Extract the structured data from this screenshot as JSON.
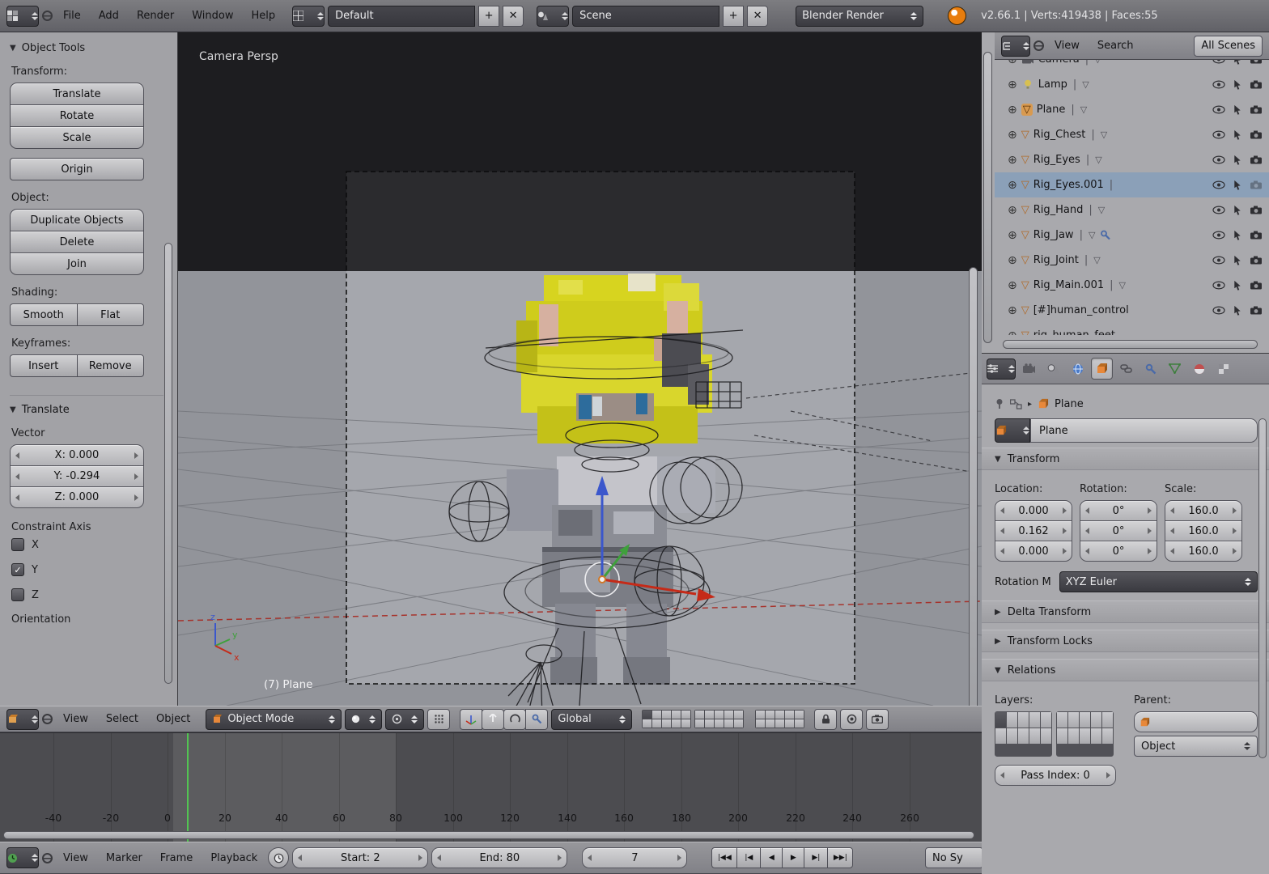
{
  "topbar": {
    "menus": [
      "File",
      "Add",
      "Render",
      "Window",
      "Help"
    ],
    "layout": "Default",
    "scene": "Scene",
    "engine": "Blender Render",
    "stats": "v2.66.1 | Verts:419438 | Faces:55"
  },
  "tool_shelf": {
    "title": "Object Tools",
    "transform_label": "Transform:",
    "translate": "Translate",
    "rotate": "Rotate",
    "scale": "Scale",
    "origin": "Origin",
    "object_label": "Object:",
    "duplicate": "Duplicate Objects",
    "delete": "Delete",
    "join": "Join",
    "shading_label": "Shading:",
    "smooth": "Smooth",
    "flat": "Flat",
    "keyframes_label": "Keyframes:",
    "insert": "Insert",
    "remove": "Remove",
    "translate_panel": "Translate",
    "vector_label": "Vector",
    "vx": "X: 0.000",
    "vy": "Y: -0.294",
    "vz": "Z: 0.000",
    "constraint_label": "Constraint Axis",
    "ax": "X",
    "ay": "Y",
    "az": "Z",
    "orientation_label": "Orientation"
  },
  "viewport": {
    "camera_label": "Camera Persp",
    "object_label": "(7) Plane",
    "menus": [
      "View",
      "Select",
      "Object"
    ],
    "mode": "Object Mode",
    "orientation": "Global",
    "axis_x": "x",
    "axis_y": "y",
    "axis_z": "z"
  },
  "timeline": {
    "ticks": [
      "-40",
      "-20",
      "0",
      "20",
      "40",
      "60",
      "80",
      "100",
      "120",
      "140",
      "160",
      "180",
      "200",
      "220",
      "240",
      "260"
    ],
    "menus": [
      "View",
      "Marker",
      "Frame",
      "Playback"
    ],
    "start": "Start: 2",
    "end": "End: 80",
    "frame": "7",
    "playback": [
      "|◀◀",
      "|◀",
      "◀",
      "▶",
      "▶|",
      "▶▶|"
    ],
    "sync": "No Sy"
  },
  "outliner": {
    "menus": [
      "View",
      "Search"
    ],
    "scope": "All Scenes",
    "items": [
      "Camera",
      "Lamp",
      "Plane",
      "Rig_Chest",
      "Rig_Eyes",
      "Rig_Eyes.001",
      "Rig_Hand",
      "Rig_Jaw",
      "Rig_Joint",
      "Rig_Main.001",
      "[#]human_control",
      "rig_human_feet"
    ]
  },
  "properties": {
    "breadcrumb": "Plane",
    "name": "Plane",
    "transform_title": "Transform",
    "location_label": "Location:",
    "rotation_label": "Rotation:",
    "scale_label": "Scale:",
    "location": [
      "0.000",
      "0.162",
      "0.000"
    ],
    "rotation": [
      "0°",
      "0°",
      "0°"
    ],
    "scale": [
      "160.0",
      "160.0",
      "160.0"
    ],
    "rotation_mode_label": "Rotation M",
    "rotation_mode": "XYZ Euler",
    "delta_title": "Delta Transform",
    "locks_title": "Transform Locks",
    "relations_title": "Relations",
    "layers_label": "Layers:",
    "parent_label": "Parent:",
    "parent_type": "Object",
    "pass_index": "Pass Index: 0"
  },
  "colors": {
    "accent_orange": "#e87d0d",
    "selection_blue": "#8ba0b8",
    "axis_x": "#c52a18",
    "axis_y": "#3fa03c",
    "axis_z": "#3b57cc",
    "current_frame_green": "#52c452"
  }
}
